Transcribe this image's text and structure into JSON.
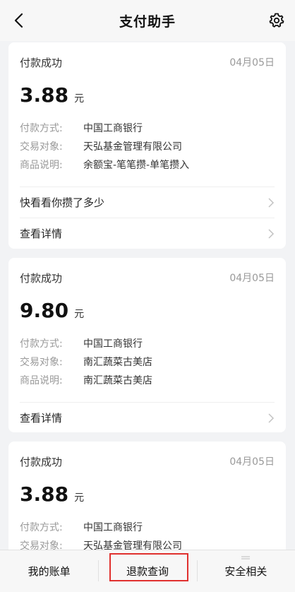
{
  "header": {
    "title": "支付助手"
  },
  "cards": [
    {
      "status": "付款成功",
      "date": "04月05日",
      "amount": "3.88",
      "unit": "元",
      "info": [
        {
          "label": "付款方式:",
          "value": "中国工商银行"
        },
        {
          "label": "交易对象:",
          "value": "天弘基金管理有限公司"
        },
        {
          "label": "商品说明:",
          "value": "余额宝-笔笔攒-单笔攒入"
        }
      ],
      "links": [
        "快看看你攒了多少",
        "查看详情"
      ]
    },
    {
      "status": "付款成功",
      "date": "04月05日",
      "amount": "9.80",
      "unit": "元",
      "info": [
        {
          "label": "付款方式:",
          "value": "中国工商银行"
        },
        {
          "label": "交易对象:",
          "value": "南汇蔬菜古美店"
        },
        {
          "label": "商品说明:",
          "value": "南汇蔬菜古美店"
        }
      ],
      "links": [
        "查看详情"
      ]
    },
    {
      "status": "付款成功",
      "date": "04月05日",
      "amount": "3.88",
      "unit": "元",
      "info": [
        {
          "label": "付款方式:",
          "value": "中国工商银行"
        },
        {
          "label": "交易对象:",
          "value": "天弘基金管理有限公司"
        }
      ]
    }
  ],
  "bottom_tabs": [
    "我的账单",
    "退款查询",
    "安全相关"
  ],
  "colors": {
    "highlight": "#e0302e",
    "background": "#f2f3f5"
  }
}
